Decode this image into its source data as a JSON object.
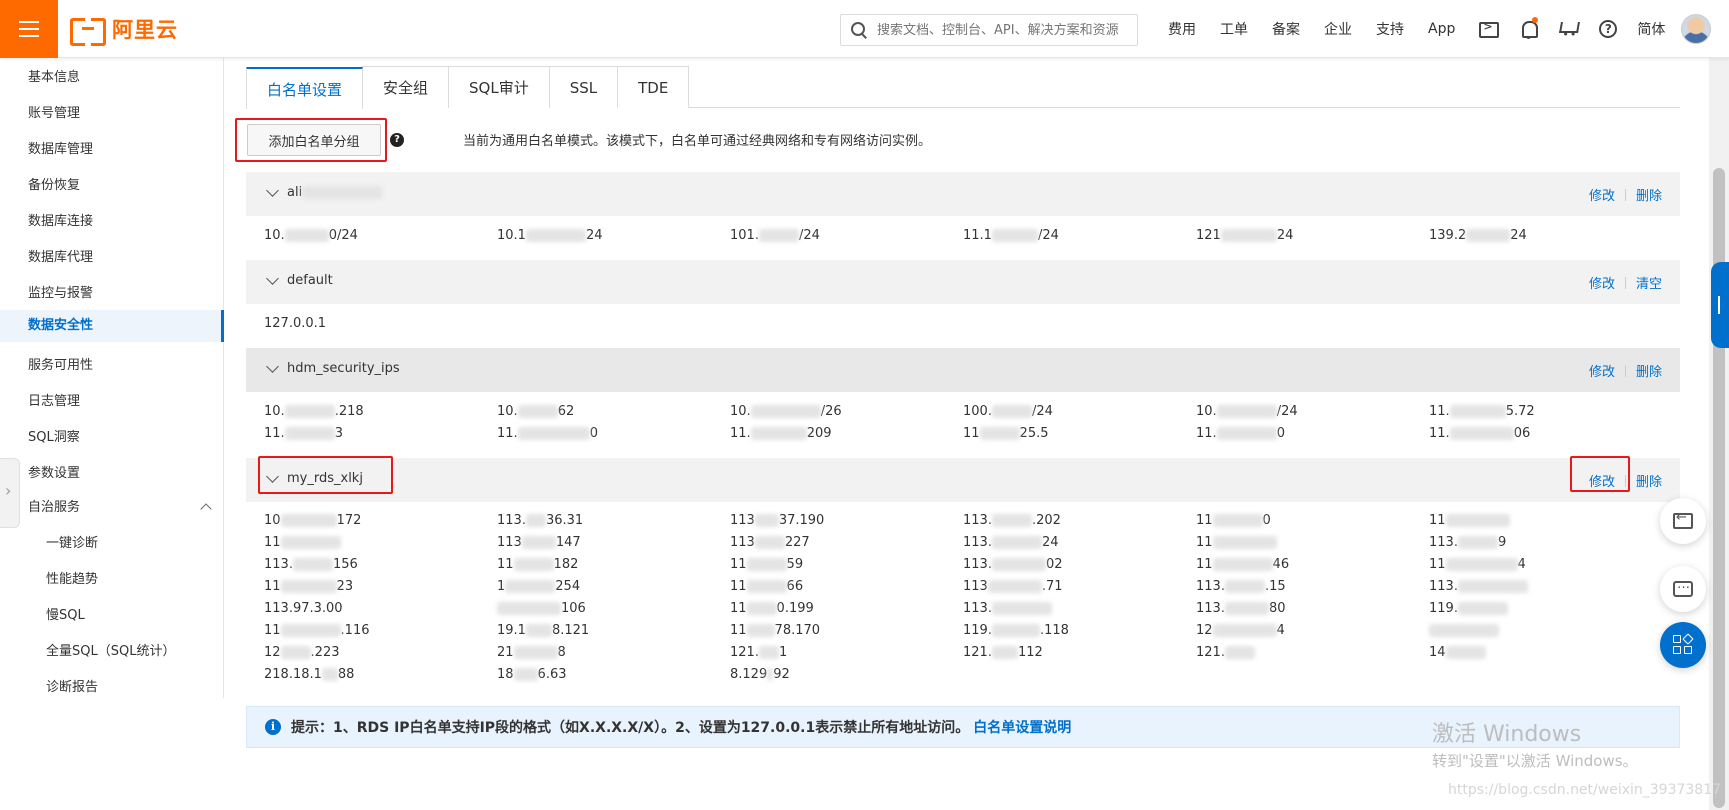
{
  "header": {
    "brand": "阿里云",
    "search_placeholder": "搜索文档、控制台、API、解决方案和资源",
    "nav": [
      "费用",
      "工单",
      "备案",
      "企业",
      "支持",
      "App"
    ],
    "lang": "简体"
  },
  "sidebar": {
    "items": [
      "基本信息",
      "账号管理",
      "数据库管理",
      "备份恢复",
      "数据库连接",
      "数据库代理",
      "监控与报警",
      "数据安全性",
      "服务可用性",
      "日志管理",
      "SQL洞察",
      "参数设置",
      "自治服务"
    ],
    "active": "数据安全性",
    "sub_items": [
      "一键诊断",
      "性能趋势",
      "慢SQL",
      "全量SQL（SQL统计）",
      "诊断报告"
    ]
  },
  "tabs": [
    "白名单设置",
    "安全组",
    "SQL审计",
    "SSL",
    "TDE"
  ],
  "toolbar": {
    "add_group_label": "添加白名单分组",
    "mode_text": "当前为通用白名单模式。该模式下，白名单可通过经典网络和专有网络访问实例。"
  },
  "groups": [
    {
      "name": "ali",
      "actions": [
        "修改",
        "删除"
      ],
      "rows": [
        [
          "10.",
          "0/24",
          "10.1",
          "24",
          "101.",
          "/24",
          "11.1",
          "/24",
          "121",
          "24",
          "139.2",
          "24"
        ]
      ]
    },
    {
      "name": "default",
      "actions": [
        "修改",
        "清空"
      ],
      "ips": [
        "127.0.0.1"
      ]
    },
    {
      "name": "hdm_security_ips",
      "actions": [
        "修改",
        "删除"
      ],
      "row1": [
        "10.",
        ".218",
        "10.",
        "62",
        "10.",
        "/26",
        "100.",
        "/24",
        "10.",
        "/24",
        "11.",
        "5.72"
      ],
      "row2": [
        "11.",
        "3",
        "11.",
        "0",
        "11.",
        "209",
        "11",
        "25.5",
        "11.",
        "0",
        "11.",
        "06"
      ]
    },
    {
      "name": "my_rds_xlkj",
      "actions": [
        "修改",
        "删除"
      ],
      "col1": [
        "10",
        "172",
        "11",
        "",
        "113.",
        "156",
        "11",
        "23",
        "113.97.3.",
        "00",
        "11",
        ".116",
        "12",
        ".223",
        "218.18.1",
        "88"
      ],
      "col2": [
        "113.",
        "36.31",
        "113",
        "147",
        "11",
        "182",
        "1",
        "254",
        "",
        "106",
        "19.1",
        "8.121",
        "21",
        "8",
        "18",
        "6.63"
      ],
      "col3": [
        "113",
        "37.190",
        "113",
        "227",
        "11",
        "59",
        "11",
        "66",
        "11",
        "0.199",
        "11",
        "78.170",
        "121.",
        "1",
        "8.129",
        "92"
      ],
      "col4": [
        "113.",
        ".202",
        "113.",
        "24",
        "113.",
        "02",
        "113",
        ".71",
        "113.",
        "",
        "119.",
        ".118",
        "121.",
        "112",
        "",
        ""
      ],
      "col5": [
        "11",
        "0",
        "11",
        "",
        "11",
        "46",
        "113.",
        ".15",
        "113.",
        "80",
        "12",
        "4",
        "121.",
        "",
        "",
        ""
      ],
      "col6": [
        "11",
        "",
        "113.",
        "9",
        "11",
        "4",
        "113.",
        "",
        "119.",
        "",
        "",
        "",
        "14",
        "",
        "",
        ""
      ]
    }
  ],
  "tip": {
    "prefix": "提示：1、RDS IP白名单支持IP段的格式（如X.X.X.X/X）。2、设置为127.0.0.1表示禁止所有地址访问。",
    "link": "白名单设置说明"
  },
  "watermark": {
    "title": "激活 Windows",
    "subtitle": "转到\"设置\"以激活 Windows。",
    "url": "https://blog.csdn.net/weixin_39373817"
  }
}
